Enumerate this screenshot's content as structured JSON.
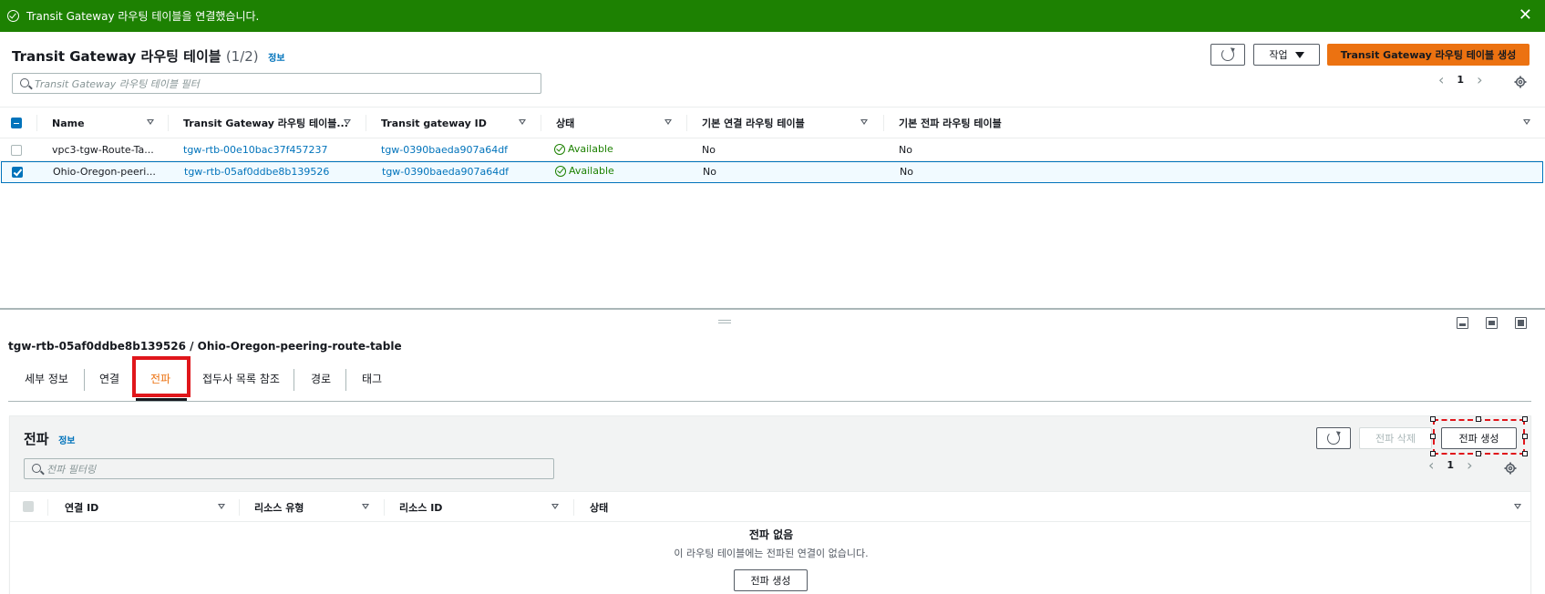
{
  "banner": {
    "message": "Transit Gateway 라우팅 테이블을 연결했습니다.",
    "close": "✕"
  },
  "header": {
    "title": "Transit Gateway 라우팅 테이블",
    "count": "(1/2)",
    "info": "정보",
    "actions_label": "작업",
    "create_label": "Transit Gateway 라우팅 테이블 생성",
    "filter_placeholder": "Transit Gateway 라우팅 테이블 필터",
    "page": "1"
  },
  "table": {
    "columns": [
      "Name",
      "Transit Gateway 라우팅 테이블...",
      "Transit gateway ID",
      "상태",
      "기본 연결 라우팅 테이블",
      "기본 전파 라우팅 테이블"
    ],
    "rows": [
      {
        "name": "vpc3-tgw-Route-Ta...",
        "rtb_id": "tgw-rtb-00e10bac37f457237",
        "tgw_id": "tgw-0390baeda907a64df",
        "status": "Available",
        "assoc": "No",
        "prop": "No",
        "selected": false
      },
      {
        "name": "Ohio-Oregon-peeri...",
        "rtb_id": "tgw-rtb-05af0ddbe8b139526",
        "tgw_id": "tgw-0390baeda907a64df",
        "status": "Available",
        "assoc": "No",
        "prop": "No",
        "selected": true
      }
    ]
  },
  "detail": {
    "title": "tgw-rtb-05af0ddbe8b139526 / Ohio-Oregon-peering-route-table",
    "tabs": [
      "세부 정보",
      "연결",
      "전파",
      "접두사 목록 참조",
      "경로",
      "태그"
    ],
    "active_tab": "전파"
  },
  "propagations": {
    "title": "전파",
    "info": "정보",
    "delete_label": "전파 삭제",
    "create_label": "전파 생성",
    "filter_placeholder": "전파 필터링",
    "page": "1",
    "columns": [
      "연결 ID",
      "리소스 유형",
      "리소스 ID",
      "상태"
    ],
    "empty_title": "전파 없음",
    "empty_message": "이 라우팅 테이블에는 전파된 연결이 없습니다.",
    "empty_button": "전파 생성"
  },
  "colors": {
    "success": "#1d8102",
    "primary": "#ec7211",
    "link": "#0073bb",
    "highlight": "#e0161b"
  }
}
